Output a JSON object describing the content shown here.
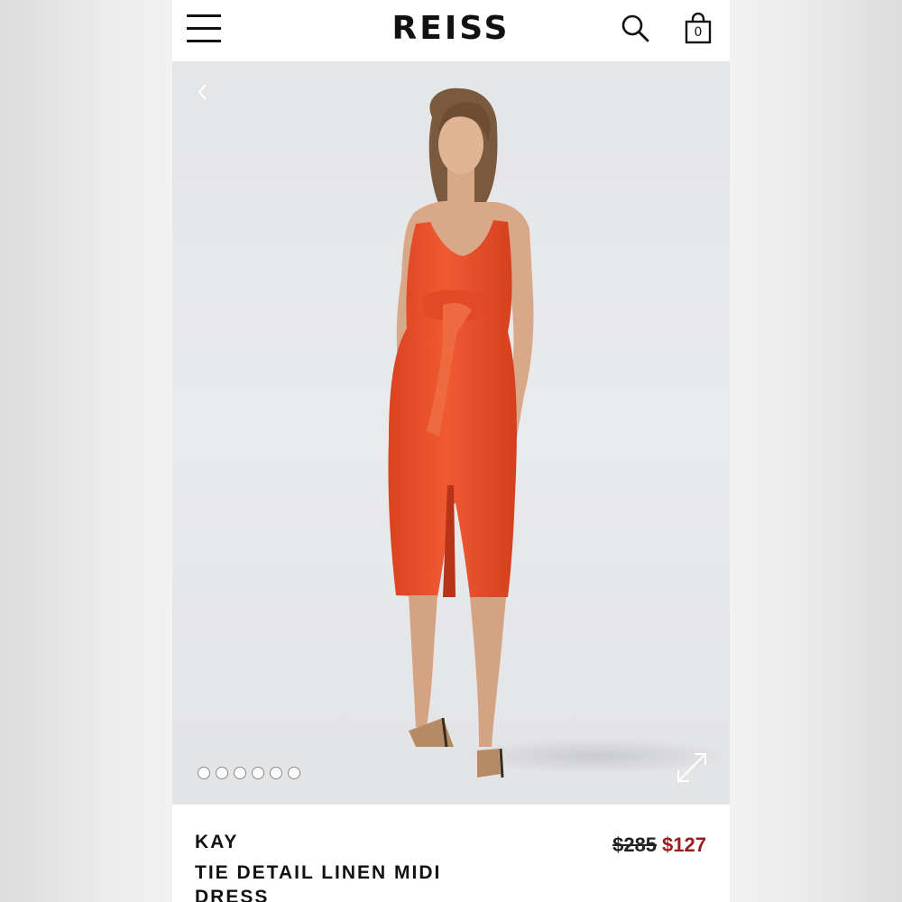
{
  "header": {
    "brand": "REISS",
    "bag_count": "0",
    "icons": [
      "hamburger-menu-icon",
      "search-icon",
      "shopping-bag-icon"
    ]
  },
  "gallery": {
    "image_count": 6,
    "active_index": 0,
    "icons": [
      "chevron-left-icon",
      "expand-icon"
    ]
  },
  "product": {
    "brand": "KAY",
    "name": "TIE DETAIL LINEN MIDI DRESS",
    "price_original": "$285",
    "price_sale": "$127"
  },
  "colors": {
    "sale_price": "#9b1c1c",
    "dress": "#e8502f",
    "background": "#e8e9eb"
  }
}
